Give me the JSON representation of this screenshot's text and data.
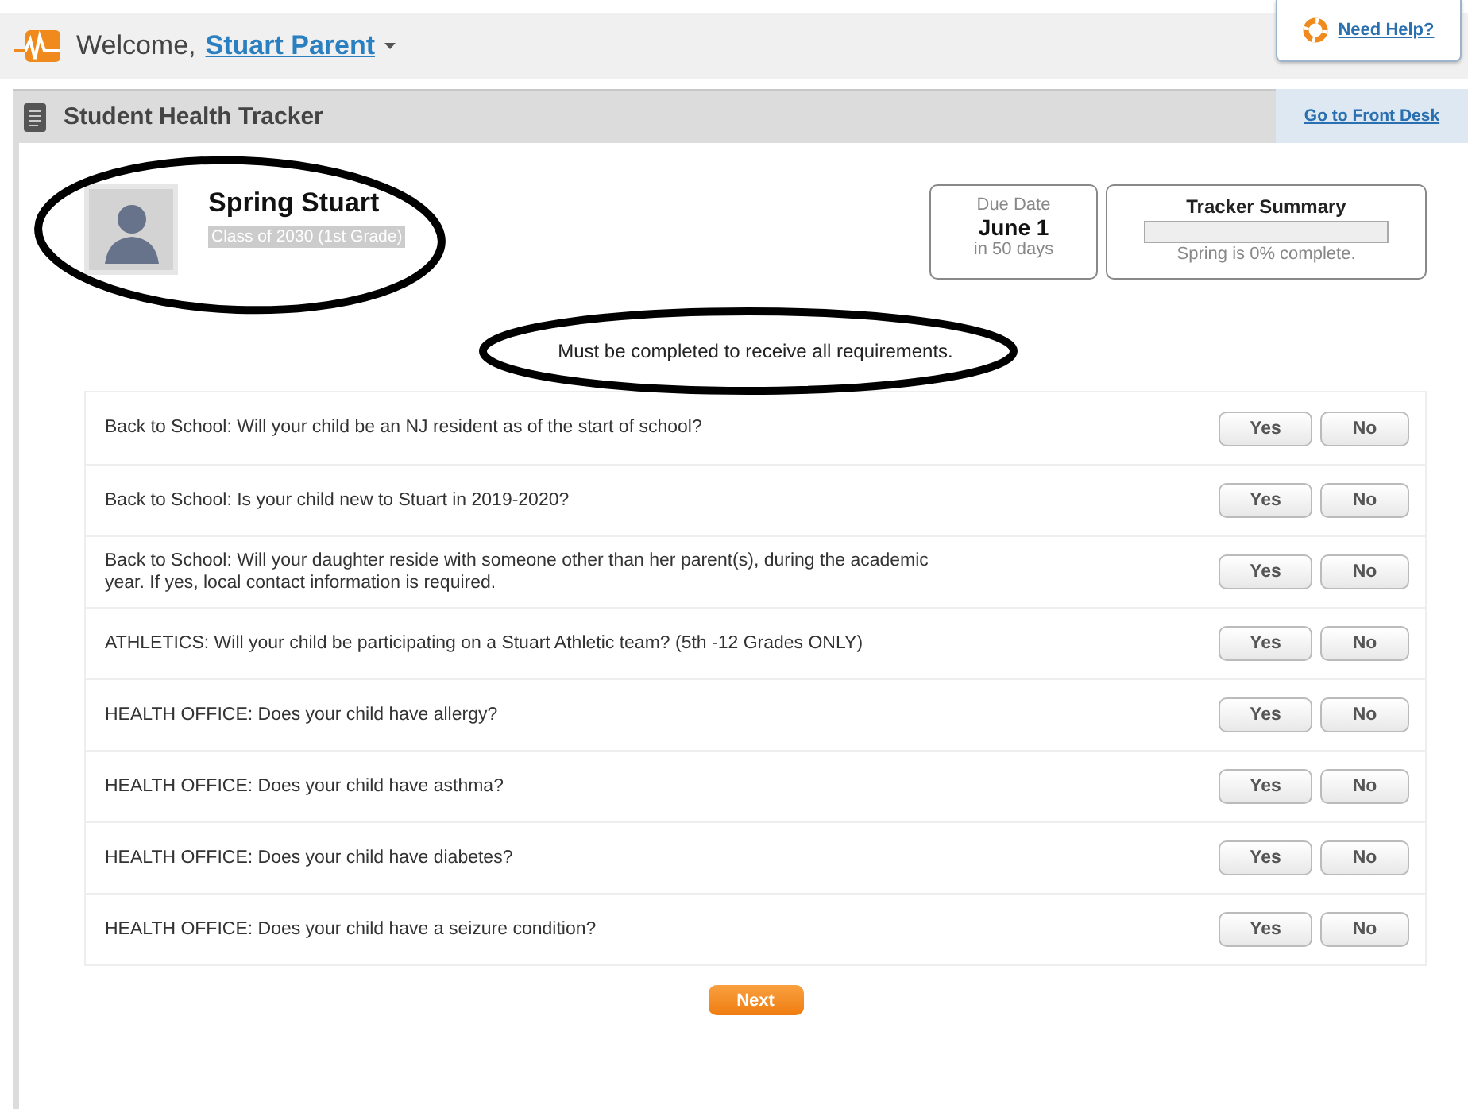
{
  "header": {
    "welcome": "Welcome,",
    "user": "Stuart Parent",
    "help": "Need Help?"
  },
  "section": {
    "title": "Student Health Tracker",
    "link": "Go to Front Desk"
  },
  "student": {
    "name": "Spring Stuart",
    "class": "Class of 2030 (1st Grade)"
  },
  "due": {
    "label": "Due Date",
    "date": "June 1",
    "remaining": "in 50 days"
  },
  "summary": {
    "title": "Tracker Summary",
    "level": 0,
    "text": "Spring is 0% complete."
  },
  "message": "Must be completed to receive all requirements.",
  "questions": [
    {
      "text": "Back to School: Will your child be an NJ resident as of the start of school?",
      "yes": "Yes",
      "no": "No"
    },
    {
      "text": "Back to School: Is your child new to Stuart in 2019-2020?",
      "yes": "Yes",
      "no": "No"
    },
    {
      "text": "Back to School: Will your daughter reside with someone other than her parent(s), during the academic year. If yes, local contact information is required.",
      "yes": "Yes",
      "no": "No"
    },
    {
      "text": "ATHLETICS: Will your child be participating on a Stuart Athletic team? (5th -12 Grades ONLY)",
      "yes": "Yes",
      "no": "No"
    },
    {
      "text": "HEALTH OFFICE: Does your child have allergy?",
      "yes": "Yes",
      "no": "No"
    },
    {
      "text": "HEALTH OFFICE: Does your child have asthma?",
      "yes": "Yes",
      "no": "No"
    },
    {
      "text": "HEALTH OFFICE: Does your child have diabetes?",
      "yes": "Yes",
      "no": "No"
    },
    {
      "text": "HEALTH OFFICE: Does your child have a seizure condition?",
      "yes": "Yes",
      "no": "No"
    }
  ],
  "next": "Next"
}
